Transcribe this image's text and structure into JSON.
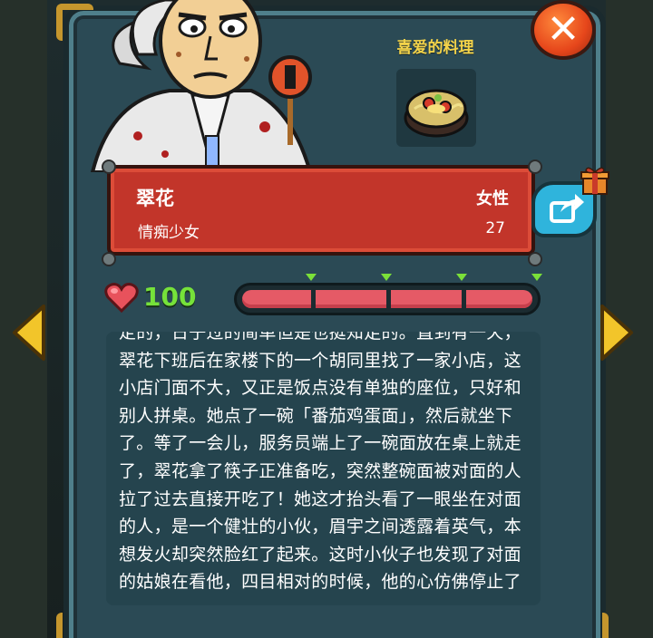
{
  "favorite_food": {
    "label": "喜爱的料理",
    "icon": "noodle-bowl-icon"
  },
  "character": {
    "name": "翠花",
    "gender": "女性",
    "title": "情痴少女",
    "age": "27"
  },
  "affinity": {
    "value": "100",
    "max_segments": 4,
    "filled_segments": 4,
    "color": "#e55a66"
  },
  "story": {
    "text": "定的，日子过的简单但是也挺知足的。直到有一天，翠花下班后在家楼下的一个胡同里找了一家小店，这小店门面不大，又正是饭点没有单独的座位，只好和别人拼桌。她点了一碗「番茄鸡蛋面」，然后就坐下了。等了一会儿，服务员端上了一碗面放在桌上就走了，翠花拿了筷子正准备吃，突然整碗面被对面的人拉了过去直接开吃了！她这才抬头看了一眼坐在对面的人，是一个健壮的小伙，眉宇之间透露着英气，本想发火却突然脸红了起来。这时小伙子也发现了对面的姑娘在看他，四目相对的时候，他的心仿佛停止了"
  },
  "buttons": {
    "close": "close-icon",
    "share": "share-icon",
    "prev": "arrow-left-icon",
    "next": "arrow-right-icon"
  },
  "colors": {
    "panel": "#2b4a55",
    "banner": "#c2352a",
    "accent_gold": "#f3d34a",
    "affinity_green": "#76e23a"
  }
}
